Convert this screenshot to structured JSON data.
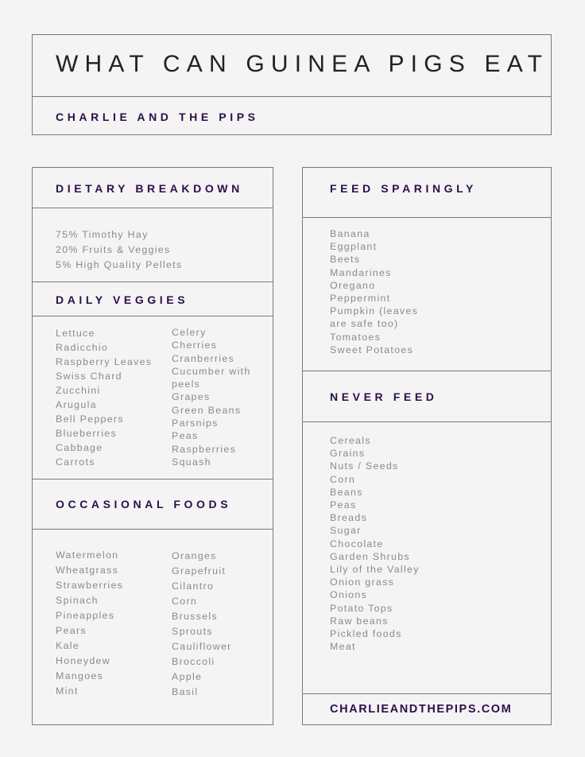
{
  "header": {
    "title": "WHAT CAN GUINEA PIGS EAT",
    "subtitle": "CHARLIE AND THE PIPS"
  },
  "dietary": {
    "heading": "DIETARY BREAKDOWN",
    "items": [
      "75% Timothy Hay",
      "20% Fruits & Veggies",
      "5% High Quality Pellets"
    ]
  },
  "daily": {
    "heading": "DAILY VEGGIES",
    "col1": [
      "Lettuce",
      "Radicchio",
      "Raspberry Leaves",
      "Swiss Chard",
      "Zucchini",
      "Arugula",
      "Bell Peppers",
      "Blueberries",
      "Cabbage",
      "Carrots"
    ],
    "col2": [
      "Celery",
      "Cherries",
      "Cranberries",
      "Cucumber with",
      "peels",
      "Grapes",
      "Green Beans",
      "Parsnips",
      "Peas",
      "Raspberries",
      "Squash"
    ]
  },
  "occasional": {
    "heading": "OCCASIONAL FOODS",
    "col1": [
      "Watermelon",
      "Wheatgrass",
      "Strawberries",
      "Spinach",
      "Pineapples",
      "Pears",
      "Kale",
      "Honeydew",
      "Mangoes",
      "Mint"
    ],
    "col2": [
      "Oranges",
      "Grapefruit",
      "Cilantro",
      "Corn",
      "Brussels",
      "Sprouts",
      "Cauliflower",
      "Broccoli",
      "Apple",
      "Basil"
    ]
  },
  "sparingly": {
    "heading": "FEED SPARINGLY",
    "items": [
      "Banana",
      "Eggplant",
      "Beets",
      "Mandarines",
      "Oregano",
      "Peppermint",
      "Pumpkin (leaves",
      "are safe too)",
      "Tomatoes",
      "Sweet Potatoes"
    ]
  },
  "never": {
    "heading": "NEVER FEED",
    "items": [
      "Cereals",
      "Grains",
      "Nuts / Seeds",
      "Corn",
      "Beans",
      "Peas",
      "Breads",
      "Sugar",
      "Chocolate",
      "Garden Shrubs",
      "Lily of the Valley",
      "Onion grass",
      "Onions",
      "Potato Tops",
      "Raw beans",
      "Pickled foods",
      "Meat"
    ]
  },
  "footer": {
    "website": "CHARLIEANDTHEPIPS.COM"
  }
}
